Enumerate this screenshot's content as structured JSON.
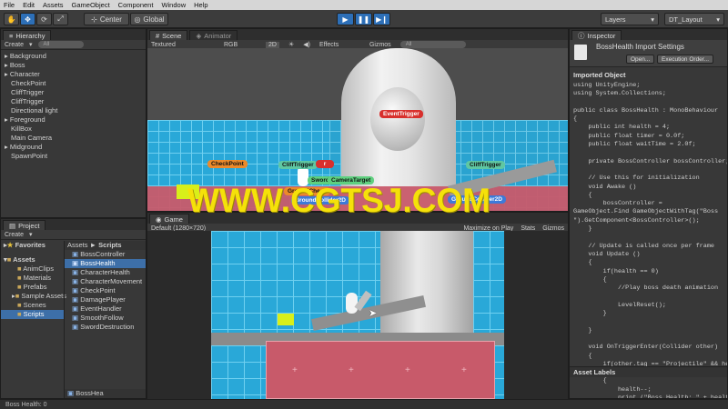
{
  "menu": [
    "File",
    "Edit",
    "Assets",
    "GameObject",
    "Component",
    "Window",
    "Help"
  ],
  "toolbar": {
    "center_label": "Center",
    "global_label": "Global",
    "layers_label": "Layers",
    "layout_label": "DT_Layout"
  },
  "hierarchy": {
    "tab": "Hierarchy",
    "create": "Create",
    "search_placeholder": "All",
    "items": [
      "Background",
      "Boss",
      "Character",
      "CheckPoint",
      "CliffTrigger",
      "CliffTrigger",
      "Directional light",
      "Foreground",
      "KillBox",
      "Main Camera",
      "Midground",
      "SpawnPoint"
    ]
  },
  "scene": {
    "tab": "Scene",
    "animator_tab": "Animator",
    "textured": "Textured",
    "rgb": "RGB",
    "mode_2d": "2D",
    "effects": "Effects",
    "gizmos": "Gizmos",
    "search_placeholder": "All",
    "labels": {
      "event_trigger": "EventTrigger",
      "check_point": "CheckPoint",
      "cliff_trigger_1": "CliffTrigger",
      "cliff_trigger_2": "CliffTrigger",
      "sword": "Sword",
      "camera_target": "CameraTarget",
      "ground_check": "GroundCheck",
      "ground_collider": "GroundCollider2D",
      "boss_label": "r"
    }
  },
  "game": {
    "tab": "Game",
    "resolution": "Default (1280×720)",
    "maximize": "Maximize on Play",
    "stats": "Stats",
    "gizmos": "Gizmos"
  },
  "project": {
    "tab": "Project",
    "create": "Create",
    "favorites": "Favorites",
    "assets": "Assets",
    "folders": [
      "AnimClips",
      "Materials",
      "Prefabs",
      "Sample Assets",
      "Scenes",
      "Scripts"
    ],
    "breadcrumb_root": "Assets",
    "breadcrumb_sep": "►",
    "breadcrumb_leaf": "Scripts",
    "files": [
      "BossController",
      "BossHealth",
      "CharacterHealth",
      "CharacterMovement",
      "CheckPoint",
      "DamagePlayer",
      "EventHandler",
      "SmoothFollow",
      "SwordDestruction"
    ],
    "bottom_file": "BossHea"
  },
  "inspector": {
    "tab": "Inspector",
    "title": "BossHealth Import Settings",
    "open_button": "Open...",
    "exec_button": "Execution Order...",
    "imported_object": "Imported Object",
    "code": "using UnityEngine;\nusing System.Collections;\n\npublic class BossHealth : MonoBehaviour\n{\n    public int health = 4;\n    public float timer = 0.0f;\n    public float waitTime = 2.0f;\n\n    private BossController bossController;\n\n    // Use this for initialization\n    void Awake ()\n    {\n        bossController =\nGameObject.Find GameObjectWithTag(\"Boss\n\").GetComponent<BossController>();\n    }\n\n    // Update is called once per frame\n    void Update ()\n    {\n        if(health == 0)\n        {\n            //Play boss death animation\n\n            LevelReset();\n        }\n\n    }\n\n    void OnTriggerEnter(Collider other)\n    {\n        if(other.tag == \"Projectile\" && health\n> 0)\n        {\n            health--;\n            print (\"Boss Health: \" + health);",
    "asset_labels": "Asset Labels"
  },
  "watermark": "WWW.CGTSJ.COM",
  "status": "Boss Health: 0",
  "colors": {
    "accent": "#2d6fb7",
    "selection": "#3d6fa8",
    "floor": "#29a8d8",
    "red_block": "#c85a6a",
    "watermark": "#f5e10a"
  }
}
